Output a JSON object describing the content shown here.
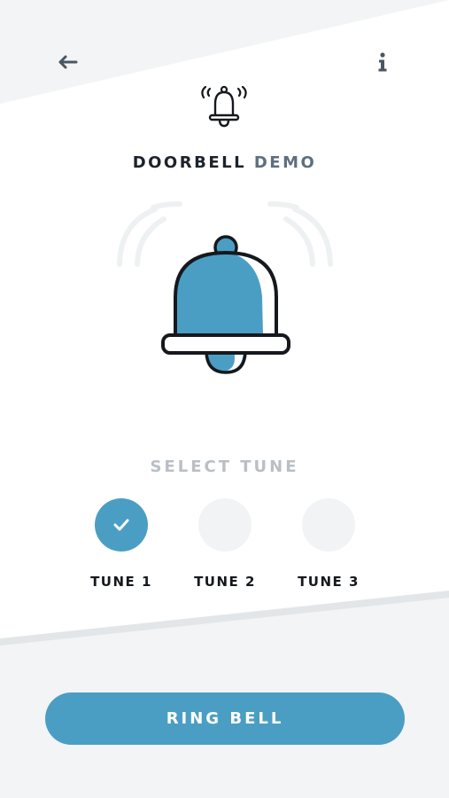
{
  "header": {
    "back_icon": "arrow-left-icon",
    "info_icon": "info-icon",
    "app_icon": "ringing-bell-icon",
    "title_primary": "DOORBELL",
    "title_secondary": "DEMO"
  },
  "hero": {
    "icon": "bell-icon"
  },
  "tunes": {
    "label": "SELECT TUNE",
    "items": [
      {
        "label": "TUNE 1",
        "selected": true
      },
      {
        "label": "TUNE 2",
        "selected": false
      },
      {
        "label": "TUNE 3",
        "selected": false
      }
    ]
  },
  "actions": {
    "ring_label": "RING BELL"
  },
  "colors": {
    "accent": "#4b9ec3",
    "title_dark": "#1c232b",
    "title_muted": "#5d6f80",
    "label_muted": "#b9bfc4",
    "unselected_circle": "#f1f3f4",
    "background": "#f2f4f5"
  }
}
